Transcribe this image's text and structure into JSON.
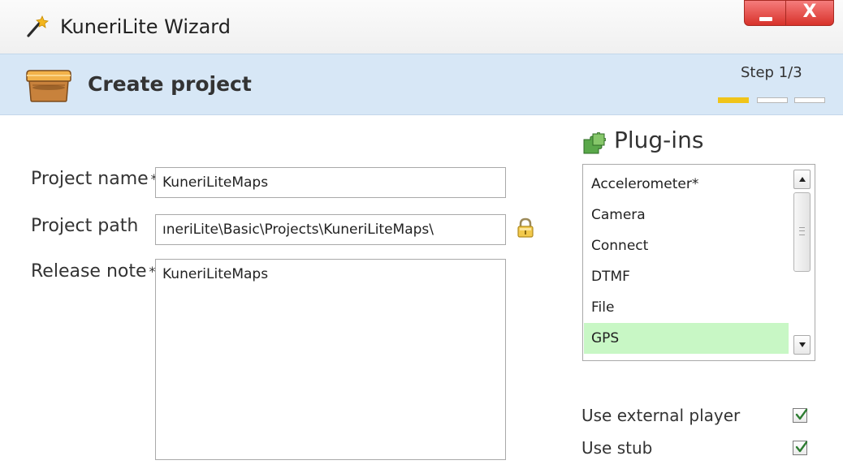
{
  "window": {
    "title": "KuneriLite Wizard",
    "close_glyph": "X"
  },
  "header": {
    "title": "Create project",
    "step_label": "Step 1/3",
    "step_current": 1,
    "step_total": 3
  },
  "form": {
    "project_name": {
      "label": "Project name",
      "required_mark": "*",
      "value": "KuneriLiteMaps"
    },
    "project_path": {
      "label": "Project path",
      "value": "ıneriLite\\Basic\\Projects\\KuneriLiteMaps\\"
    },
    "release_note": {
      "label": "Release note",
      "required_mark": "*",
      "value": "KuneriLiteMaps"
    }
  },
  "plugins": {
    "title": "Plug-ins",
    "items": [
      {
        "label": "Accelerometer*",
        "selected": false
      },
      {
        "label": "Camera",
        "selected": false
      },
      {
        "label": "Connect",
        "selected": false
      },
      {
        "label": "DTMF",
        "selected": false
      },
      {
        "label": "File",
        "selected": false
      },
      {
        "label": "GPS",
        "selected": true
      }
    ],
    "selected_color": "#c8f7c5"
  },
  "options": {
    "use_external_player": {
      "label": "Use external player",
      "checked": true
    },
    "use_stub": {
      "label": "Use stub",
      "checked": true
    }
  },
  "colors": {
    "header_band": "#d7e7f6",
    "step_active": "#f0c419",
    "close_red": "#d8322a",
    "checkmark_green": "#2e7d32"
  },
  "icons": {
    "title": "wizard-wand-icon",
    "header": "box-icon",
    "path": "lock-icon",
    "plugins": "puzzle-pieces-icon"
  }
}
